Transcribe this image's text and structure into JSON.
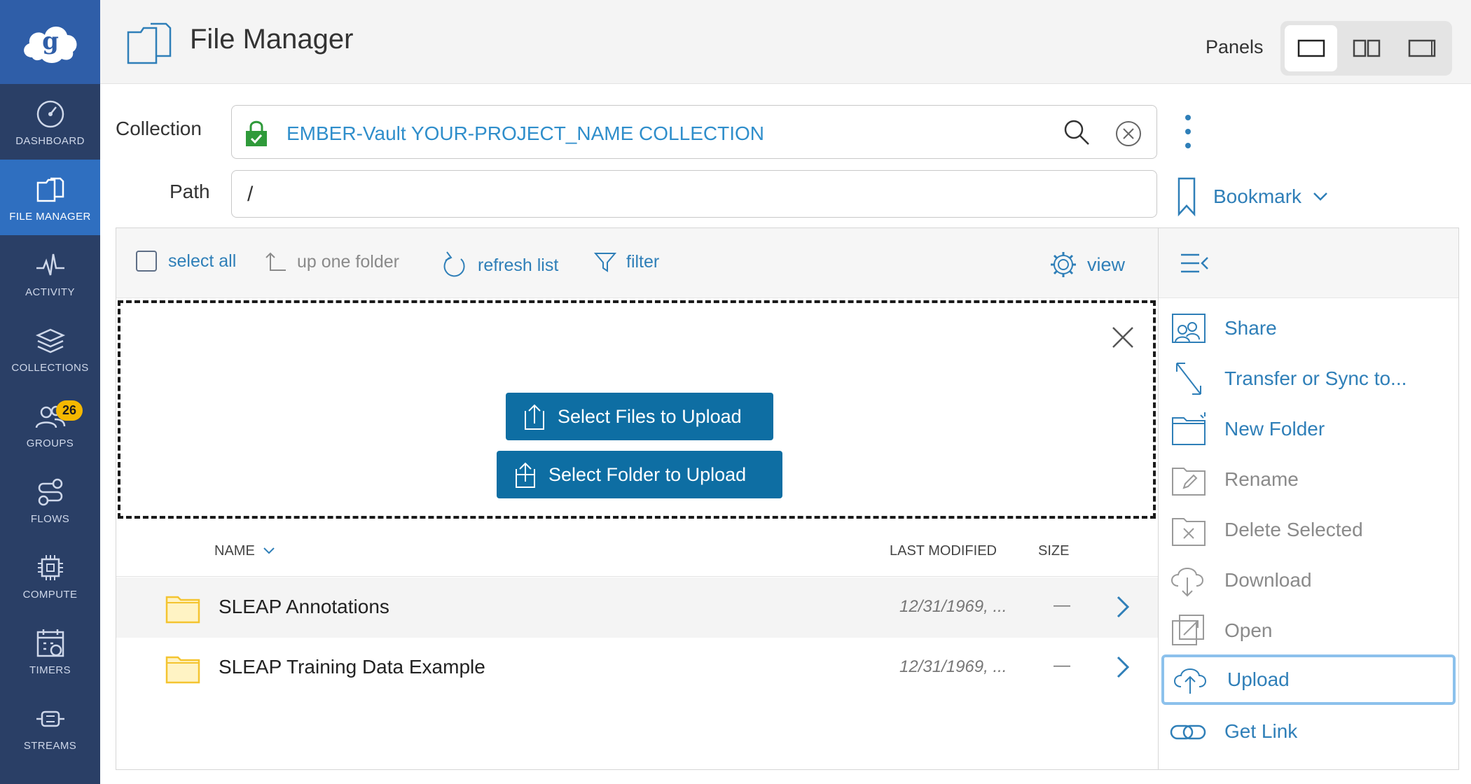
{
  "sidebar": {
    "logo_icon": "globus-cloud-logo",
    "items": [
      {
        "label": "DASHBOARD",
        "icon": "dashboard-icon",
        "active": false
      },
      {
        "label": "FILE MANAGER",
        "icon": "file-manager-icon",
        "active": true
      },
      {
        "label": "ACTIVITY",
        "icon": "activity-icon",
        "active": false
      },
      {
        "label": "COLLECTIONS",
        "icon": "collections-icon",
        "active": false
      },
      {
        "label": "GROUPS",
        "icon": "groups-icon",
        "active": false,
        "badge": "26"
      },
      {
        "label": "FLOWS",
        "icon": "flows-icon",
        "active": false
      },
      {
        "label": "COMPUTE",
        "icon": "compute-icon",
        "active": false
      },
      {
        "label": "TIMERS",
        "icon": "timers-icon",
        "active": false
      },
      {
        "label": "STREAMS",
        "icon": "streams-icon",
        "active": false
      }
    ]
  },
  "header": {
    "title": "File Manager",
    "panels_label": "Panels",
    "panel_layouts": [
      "single-panel-icon",
      "double-panel-icon",
      "single-panel-alt-icon"
    ]
  },
  "collection": {
    "label": "Collection",
    "value": "EMBER-Vault YOUR-PROJECT_NAME COLLECTION"
  },
  "path": {
    "label": "Path",
    "value": "/"
  },
  "bookmark": {
    "label": "Bookmark"
  },
  "toolbar": {
    "select_all": "select all",
    "up_one_folder": "up one folder",
    "refresh_list": "refresh list",
    "filter": "filter",
    "view": "view"
  },
  "upload_zone": {
    "select_files": "Select Files to Upload",
    "select_folder": "Select Folder to Upload"
  },
  "table": {
    "columns": {
      "name": "NAME",
      "last_modified": "LAST MODIFIED",
      "size": "SIZE"
    },
    "rows": [
      {
        "name": "SLEAP Annotations",
        "last_modified": "12/31/1969, ...",
        "size": "—"
      },
      {
        "name": "SLEAP Training Data Example",
        "last_modified": "12/31/1969, ...",
        "size": "—"
      }
    ]
  },
  "actions": [
    {
      "label": "Share",
      "icon": "share-icon",
      "enabled": true
    },
    {
      "label": "Transfer or Sync to...",
      "icon": "transfer-icon",
      "enabled": true
    },
    {
      "label": "New Folder",
      "icon": "new-folder-icon",
      "enabled": true
    },
    {
      "label": "Rename",
      "icon": "rename-icon",
      "enabled": false
    },
    {
      "label": "Delete Selected",
      "icon": "delete-icon",
      "enabled": false
    },
    {
      "label": "Download",
      "icon": "download-icon",
      "enabled": false
    },
    {
      "label": "Open",
      "icon": "open-icon",
      "enabled": false
    },
    {
      "label": "Upload",
      "icon": "upload-icon",
      "enabled": true,
      "selected": true
    },
    {
      "label": "Get Link",
      "icon": "link-icon",
      "enabled": true
    }
  ],
  "colors": {
    "sidebar_bg": "#2a3f66",
    "sidebar_active": "#2f6fc0",
    "accent_blue": "#2f7fb8",
    "button_blue": "#0e6ea3",
    "badge_yellow": "#f5b800",
    "lock_green": "#2f9a3a",
    "folder_yellow": "#f4c430"
  }
}
